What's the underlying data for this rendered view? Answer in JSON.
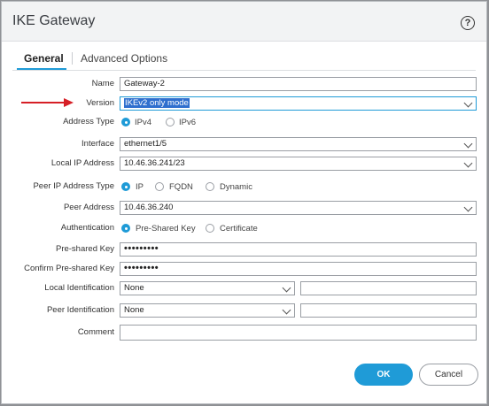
{
  "dialog": {
    "title": "IKE Gateway"
  },
  "tabs": [
    {
      "label": "General",
      "active": true
    },
    {
      "label": "Advanced Options",
      "active": false
    }
  ],
  "form": {
    "name": {
      "label": "Name",
      "value": "Gateway-2"
    },
    "version": {
      "label": "Version",
      "value": "IKEv2 only mode"
    },
    "address_type": {
      "label": "Address Type",
      "options": [
        "IPv4",
        "IPv6"
      ],
      "selected": "IPv4"
    },
    "interface": {
      "label": "Interface",
      "value": "ethernet1/5"
    },
    "local_ip": {
      "label": "Local IP Address",
      "value": "10.46.36.241/23"
    },
    "peer_ip_type": {
      "label": "Peer IP Address Type",
      "options": [
        "IP",
        "FQDN",
        "Dynamic"
      ],
      "selected": "IP"
    },
    "peer_address": {
      "label": "Peer Address",
      "value": "10.46.36.240"
    },
    "authentication": {
      "label": "Authentication",
      "options": [
        "Pre-Shared Key",
        "Certificate"
      ],
      "selected": "Pre-Shared Key"
    },
    "preshared_key": {
      "label": "Pre-shared Key",
      "value": "•••••••••"
    },
    "confirm_preshared_key": {
      "label": "Confirm Pre-shared Key",
      "value": "•••••••••"
    },
    "local_identification": {
      "label": "Local Identification",
      "value": "None",
      "text": ""
    },
    "peer_identification": {
      "label": "Peer Identification",
      "value": "None",
      "text": ""
    },
    "comment": {
      "label": "Comment",
      "value": ""
    }
  },
  "buttons": {
    "ok": "OK",
    "cancel": "Cancel"
  },
  "colors": {
    "accent": "#1f9bd7",
    "arrow": "#d61f26",
    "selection": "#2f6fce"
  },
  "icons": {
    "help": "help-circle-icon",
    "dropdown": "chevron-down-icon",
    "annotation": "red-arrow-icon"
  }
}
